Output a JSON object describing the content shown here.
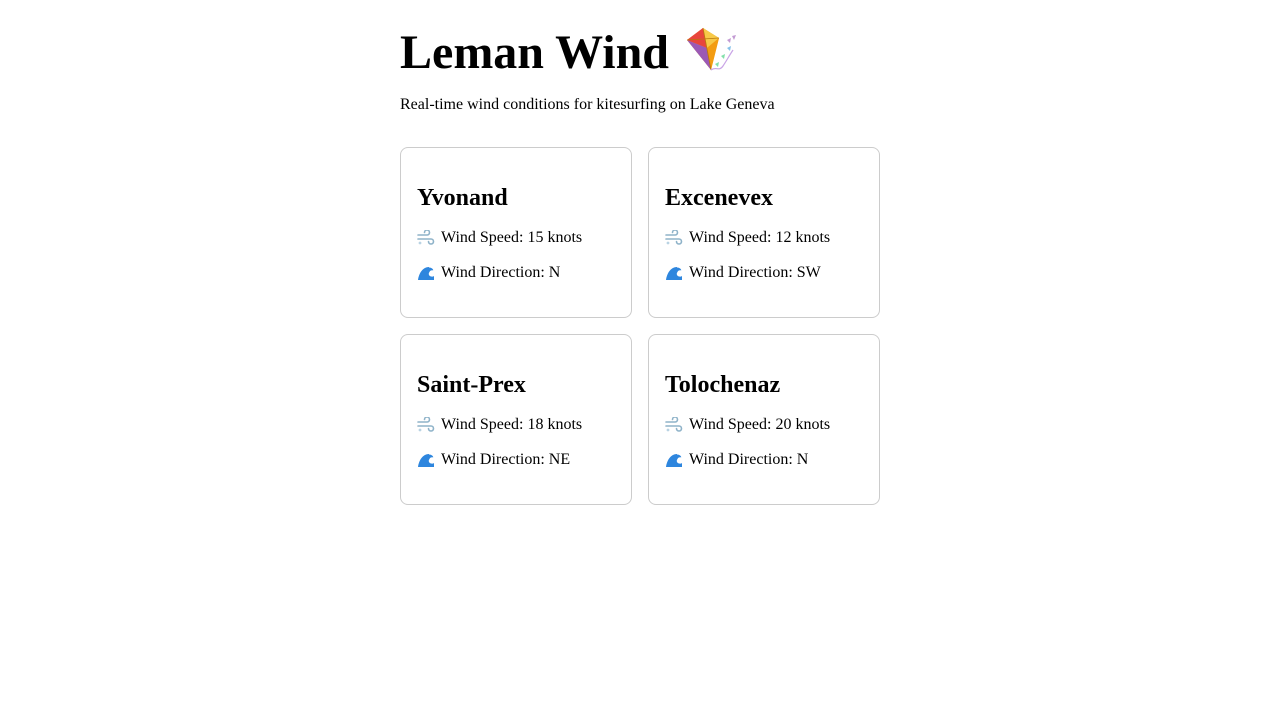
{
  "header": {
    "title": "Leman Wind",
    "subtitle": "Real-time wind conditions for kitesurfing on Lake Geneva",
    "title_icon": "kite-icon"
  },
  "icons": {
    "speed": "wind-blow-icon",
    "direction": "water-wave-icon"
  },
  "spots": [
    {
      "name": "Yvonand",
      "speed": "Wind Speed: 15 knots",
      "direction": "Wind Direction: N"
    },
    {
      "name": "Excenevex",
      "speed": "Wind Speed: 12 knots",
      "direction": "Wind Direction: SW"
    },
    {
      "name": "Saint-Prex",
      "speed": "Wind Speed: 18 knots",
      "direction": "Wind Direction: NE"
    },
    {
      "name": "Tolochenaz",
      "speed": "Wind Speed: 20 knots",
      "direction": "Wind Direction: N"
    }
  ]
}
